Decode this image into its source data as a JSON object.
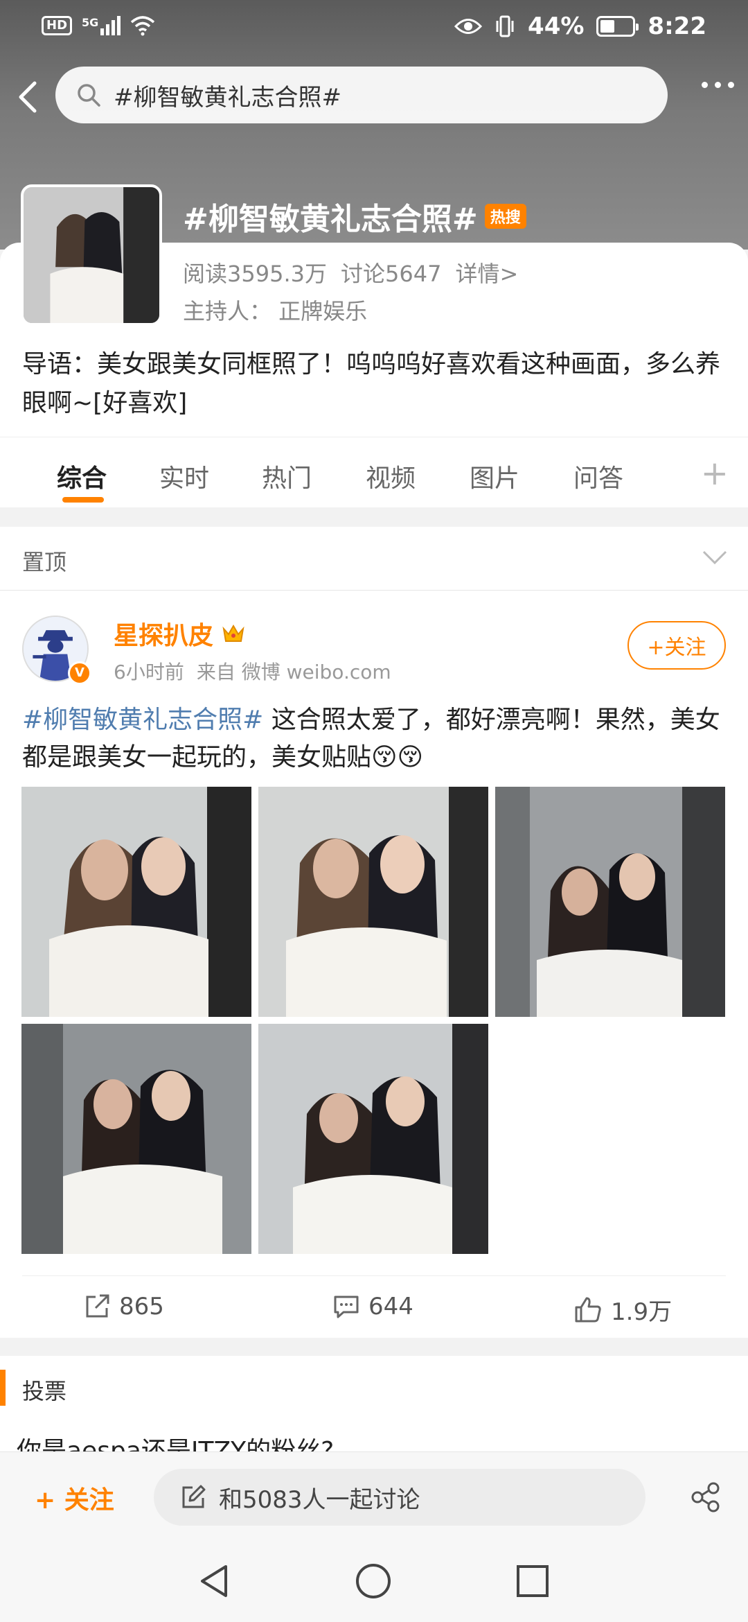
{
  "status_bar": {
    "hd": "HD",
    "network": "5G",
    "battery": "44%",
    "time": "8:22"
  },
  "search": {
    "query": "#柳智敏黄礼志合照#"
  },
  "topic": {
    "title": "#柳智敏黄礼志合照#",
    "hot_badge": "热搜",
    "reads": "阅读3595.3万",
    "discussions": "讨论5647",
    "details": "详情>",
    "host": "主持人：  正牌娱乐",
    "intro": "导语：美女跟美女同框照了！呜呜呜好喜欢看这种画面，多么养眼啊~[好喜欢]"
  },
  "tabs": [
    "综合",
    "实时",
    "热门",
    "视频",
    "图片",
    "问答"
  ],
  "pinned": {
    "label": "置顶"
  },
  "post": {
    "author": "星探扒皮",
    "time": "6小时前",
    "source": "来自 微博 weibo.com",
    "follow": "+关注",
    "hashtag": "#柳智敏黄礼志合照#",
    "text": " 这合照太爱了，都好漂亮啊！果然，美女都是跟美女一起玩的，美女贴贴😚😚",
    "reposts": "865",
    "comments": "644",
    "likes": "1.9万"
  },
  "vote": {
    "label": "投票",
    "question": "你是aespa还是ITZY的粉丝?"
  },
  "bottom": {
    "follow": "+ 关注",
    "discuss": "和5083人一起讨论"
  },
  "colors": {
    "accent": "#ff8200",
    "link": "#507daf"
  }
}
